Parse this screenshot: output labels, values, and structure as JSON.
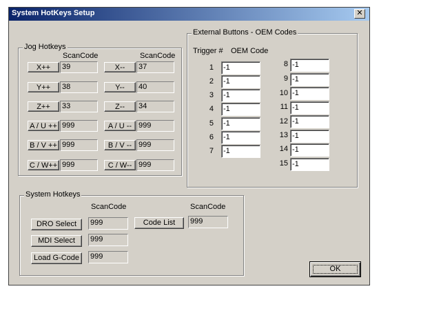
{
  "window": {
    "title": "System HotKeys Setup",
    "close_glyph": "✕"
  },
  "jog": {
    "legend": "Jog Hotkeys",
    "scancode_header_left": "ScanCode",
    "scancode_header_right": "ScanCode",
    "left": [
      {
        "label": "X++",
        "value": "39"
      },
      {
        "label": "Y++",
        "value": "38"
      },
      {
        "label": "Z++",
        "value": "33"
      },
      {
        "label": "A / U ++",
        "value": "999"
      },
      {
        "label": "B / V ++",
        "value": "999"
      },
      {
        "label": "C / W++",
        "value": "999"
      }
    ],
    "right": [
      {
        "label": "X--",
        "value": "37"
      },
      {
        "label": "Y--",
        "value": "40"
      },
      {
        "label": "Z--",
        "value": "34"
      },
      {
        "label": "A / U --",
        "value": "999"
      },
      {
        "label": "B / V --",
        "value": "999"
      },
      {
        "label": "C / W--",
        "value": "999"
      }
    ]
  },
  "external": {
    "legend": "External Buttons - OEM Codes",
    "trigger_header": "Trigger  #",
    "oem_header": "OEM Code",
    "left": [
      {
        "num": "1",
        "value": "-1"
      },
      {
        "num": "2",
        "value": "-1"
      },
      {
        "num": "3",
        "value": "-1"
      },
      {
        "num": "4",
        "value": "-1"
      },
      {
        "num": "5",
        "value": "-1"
      },
      {
        "num": "6",
        "value": "-1"
      },
      {
        "num": "7",
        "value": "-1"
      }
    ],
    "right": [
      {
        "num": "8",
        "value": "-1"
      },
      {
        "num": "9",
        "value": "-1"
      },
      {
        "num": "10",
        "value": "-1"
      },
      {
        "num": "11",
        "value": "-1"
      },
      {
        "num": "12",
        "value": "-1"
      },
      {
        "num": "13",
        "value": "-1"
      },
      {
        "num": "14",
        "value": "-1"
      },
      {
        "num": "15",
        "value": "-1"
      }
    ]
  },
  "system": {
    "legend": "System Hotkeys",
    "scancode_header_left": "ScanCode",
    "scancode_header_right": "ScanCode",
    "dro_select": {
      "label": "DRO Select",
      "value": "999"
    },
    "mdi_select": {
      "label": "MDI Select",
      "value": "999"
    },
    "load_gcode": {
      "label": "Load G-Code",
      "value": "999"
    },
    "code_list": {
      "label": "Code List",
      "value": "999"
    }
  },
  "ok_label": "OK"
}
